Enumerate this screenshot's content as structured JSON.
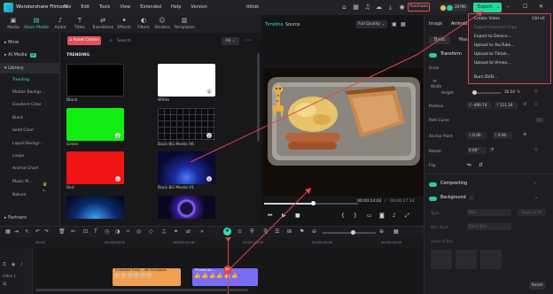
{
  "titlebar": {
    "app_name": "Wondershare Filmora",
    "menus": [
      "File",
      "Edit",
      "Tools",
      "View",
      "Extended",
      "Help",
      "Version"
    ],
    "project_name": "tiktok",
    "purchase_label": "Purchase",
    "credits": "28790",
    "export_label": "Export"
  },
  "toolbar": {
    "items": [
      {
        "label": "Media",
        "icon": "media-icon"
      },
      {
        "label": "Stock Media",
        "icon": "stock-media-icon"
      },
      {
        "label": "Audio",
        "icon": "audio-icon"
      },
      {
        "label": "Titles",
        "icon": "titles-icon"
      },
      {
        "label": "Transitions",
        "icon": "transitions-icon"
      },
      {
        "label": "Effects",
        "icon": "effects-icon"
      },
      {
        "label": "Filters",
        "icon": "filters-icon"
      },
      {
        "label": "Stickers",
        "icon": "stickers-icon"
      },
      {
        "label": "Templates",
        "icon": "templates-icon"
      }
    ]
  },
  "sidebar": {
    "mine": "Mine",
    "ai_media": "AI Media",
    "ai_badge": "AI",
    "library": "Library",
    "items": [
      "Trending",
      "Motion Backgr...",
      "Gradient Color",
      "Black",
      "Solid Color",
      "Liquid Backgr...",
      "Loops",
      "Animal Chart",
      "Music M...",
      "Nature"
    ],
    "partners": "Partners"
  },
  "media": {
    "asset_center": "Asset Center",
    "search_placeholder": "Search",
    "filter_label": "All",
    "section_title": "TRENDING",
    "thumbs": [
      {
        "caption": "Black",
        "color": "#000000"
      },
      {
        "caption": "White",
        "color": "#ffffff"
      },
      {
        "caption": "Green",
        "color": "#12ee12"
      },
      {
        "caption": "Back BG Media 06",
        "color": "#0b0b10"
      },
      {
        "caption": "Red",
        "color": "#f01414"
      },
      {
        "caption": "Back BG Media 01",
        "color": "#0a1050"
      },
      {
        "caption": "",
        "color": "#0b2a6a"
      },
      {
        "caption": "",
        "color": "#1b1040"
      }
    ]
  },
  "player": {
    "tab_timeline": "Timeline",
    "tab_source": "Source",
    "quality": "Full Quality",
    "current_time": "00:00:14:02",
    "total_time": "00:00:27:14",
    "progress": 0.52
  },
  "dropdown": {
    "items": [
      {
        "label": "Create Video",
        "shortcut": "Ctrl+E",
        "dim": false
      },
      {
        "label": "Export Selected Clips",
        "shortcut": "",
        "dim": true
      },
      {
        "label": "Export to Device...",
        "shortcut": "",
        "dim": false
      },
      {
        "label": "Upload to YouTube...",
        "shortcut": "",
        "dim": false
      },
      {
        "label": "Upload to Tiktok...",
        "shortcut": "",
        "dim": false
      },
      {
        "label": "Upload to Vimeo...",
        "shortcut": "",
        "dim": false
      },
      {
        "label": "Burn DVD...",
        "shortcut": "",
        "dim": false
      }
    ]
  },
  "properties": {
    "tab_image": "Image",
    "tab_animation": "Animati...",
    "sub_basic": "Basic",
    "sub_mask": "Mas...",
    "transform": "Transform",
    "scale": "Scale",
    "width": "Width",
    "height": "Height",
    "scale_value": "30.50",
    "scale_unit": "%",
    "position": "Position",
    "pos_x": "-490.74",
    "pos_y": "111.24",
    "path_curve": "Path Curve",
    "anchor_point": "Anchor Point",
    "anchor_x": "0.00",
    "anchor_y": "0.00",
    "rotate": "Rotate",
    "rotate_value": "0.00°",
    "flip": "Flip",
    "compositing": "Compositing",
    "background": "Background",
    "type_label": "Type",
    "type_value": "Blur",
    "apply_all": "Apply to All",
    "blur_style": "Blur Style",
    "blur_style_value": "Basic Blur",
    "level_label": "Level of Blur",
    "reset": "Reset"
  },
  "timeline": {
    "ruler": [
      "00:00",
      "00:00:05:00",
      "00:00:10:00",
      "00:00:15:00",
      "00:00:20:00",
      "00:00:25:00"
    ],
    "track_label": "Video 1",
    "clip1": "Animated Emoji ...die Sunglasse",
    "clip2": "Thumb Up..."
  },
  "colors": {
    "accent": "#30e0c0",
    "export_green": "#22d99d",
    "annotation_red": "#e0444c",
    "clip_orange": "#f0a050",
    "clip_purple": "#7b6cf6"
  }
}
